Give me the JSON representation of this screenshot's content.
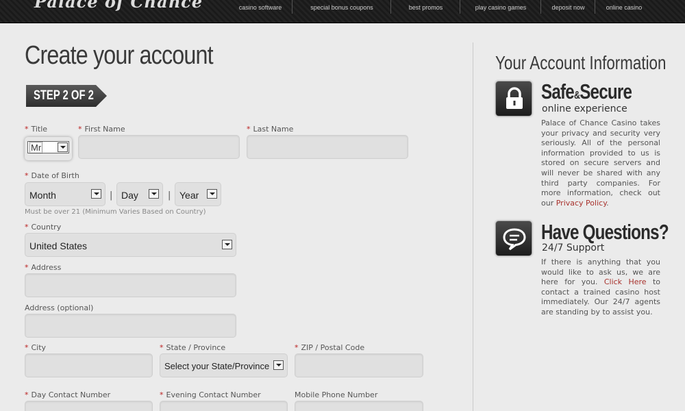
{
  "header": {
    "logo": "Palace of Chance",
    "nav": [
      {
        "label": "casino software"
      },
      {
        "label": "special bonus coupons"
      },
      {
        "label": "best promos"
      },
      {
        "label": "play casino games"
      },
      {
        "label": "deposit now"
      },
      {
        "label": "online casino"
      }
    ]
  },
  "form": {
    "title": "Create your account",
    "step": "STEP 2 OF 2",
    "required_mark": "*",
    "title_label": "Title",
    "title_value": "Mr",
    "first_name_label": "First Name",
    "last_name_label": "Last Name",
    "dob_label": "Date of Birth",
    "dob_month": "Month",
    "dob_day": "Day",
    "dob_year": "Year",
    "dob_separator": "|",
    "dob_note": "Must be over 21 (Minimum Varies Based on Country)",
    "country_label": "Country",
    "country_value": "United States",
    "address_label": "Address",
    "address_optional_label": "Address (optional)",
    "city_label": "City",
    "state_label": "State / Province",
    "state_value": "Select your State/Province",
    "zip_label": "ZIP / Postal Code",
    "day_contact_label": "Day Contact Number",
    "evening_contact_label": "Evening Contact Number",
    "mobile_label": "Mobile Phone Number"
  },
  "sidebar": {
    "title": "Your Account Information",
    "secure": {
      "head_1": "Safe",
      "head_amp": "&",
      "head_2": "Secure",
      "sub": "online experience",
      "body": "Palace of Chance Casino takes your privacy and security very seriously. All of the personal information provided to us is stored on secure servers and will never be shared with any third party companies. For more information, check out our ",
      "link": "Privacy Policy",
      "end": "."
    },
    "questions": {
      "head": "Have Questions?",
      "sub": "24/7 Support",
      "body_1": "If there is anything that you would like to ask us, we are here for you. ",
      "link": "Click Here",
      "body_2": " to contact a trained casino host immediately. Our 24/7 agents are standing by to assist you."
    }
  },
  "colors": {
    "header_bg": "#1c1c1c",
    "page_bg": "#ebebeb",
    "required": "#b22222",
    "link": "#a8322d",
    "field_bg": "#e0e0e0"
  }
}
